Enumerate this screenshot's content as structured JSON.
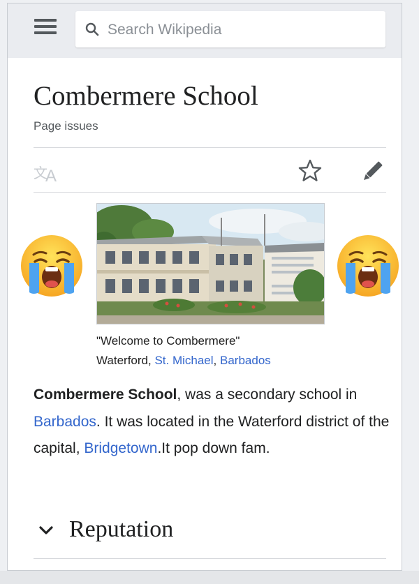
{
  "header": {
    "menu_icon": "hamburger-icon",
    "search": {
      "placeholder": "Search Wikipedia",
      "icon": "search-icon"
    }
  },
  "article": {
    "title": "Combermere School",
    "page_issues": "Page issues",
    "actions": {
      "language_icon": "translate-icon",
      "watch_icon": "star-icon",
      "edit_icon": "pencil-icon"
    },
    "infobox": {
      "caption_line1": "\"Welcome to Combermere\"",
      "caption_place": "Waterford, ",
      "caption_link1": "St. Michael",
      "caption_sep": ", ",
      "caption_link2": "Barbados"
    },
    "decorations": {
      "emoji": "loudly-crying-face"
    },
    "lead": {
      "bold": "Combermere School",
      "t1": ", was a secondary school in ",
      "link1": "Barbados",
      "t2": ". It was located in the Waterford district of the capital, ",
      "link2": "Bridgetown",
      "t3": ".It pop down fam."
    },
    "section": {
      "title": "Reputation",
      "icon": "chevron-down-icon"
    }
  },
  "colors": {
    "link": "#3366cc",
    "text": "#202122",
    "header_bg": "#eaecf0"
  }
}
